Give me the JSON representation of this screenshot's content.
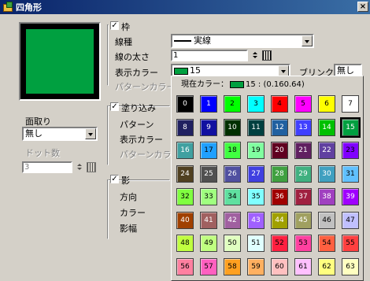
{
  "window": {
    "title": "四角形",
    "close": "×"
  },
  "frame": {
    "enabled_label": "枠",
    "line_type_label": "線種",
    "line_type_value": "実線",
    "line_width_label": "線の太さ",
    "line_width_value": "1",
    "display_color_label": "表示カラー",
    "display_color_value": "15",
    "display_color_swatch": "#00a040",
    "blink_label": "ブリンク",
    "blink_value": "無し",
    "pattern_color_label": "パターンカラー"
  },
  "chamfer": {
    "label": "面取り",
    "value": "無し",
    "dots_label": "ドット数",
    "dots_value": "3"
  },
  "fill": {
    "enabled_label": "塗り込み",
    "pattern_label": "パターン",
    "display_color_label": "表示カラー",
    "pattern_color_label": "パターンカラー"
  },
  "shadow": {
    "enabled_label": "影",
    "direction_label": "方向",
    "color_label": "カラー",
    "width_label": "影幅"
  },
  "palette": {
    "current_label": "現在カラー：",
    "current_value": "15 : (0.160.64)",
    "selected": 15,
    "cells": [
      {
        "n": "0",
        "bg": "#000000",
        "fg": "#ffffff"
      },
      {
        "n": "1",
        "bg": "#0000ff",
        "fg": "#ffffff"
      },
      {
        "n": "2",
        "bg": "#00ff00",
        "fg": "#000000"
      },
      {
        "n": "3",
        "bg": "#00ffff",
        "fg": "#000000"
      },
      {
        "n": "4",
        "bg": "#ff0000",
        "fg": "#000000"
      },
      {
        "n": "5",
        "bg": "#ff00ff",
        "fg": "#000000"
      },
      {
        "n": "6",
        "bg": "#ffff00",
        "fg": "#000000"
      },
      {
        "n": "7",
        "bg": "#ffffff",
        "fg": "#000000"
      },
      {
        "n": "8",
        "bg": "#202060",
        "fg": "#ffffff"
      },
      {
        "n": "9",
        "bg": "#1010a0",
        "fg": "#ffffff"
      },
      {
        "n": "10",
        "bg": "#003000",
        "fg": "#ffffff"
      },
      {
        "n": "11",
        "bg": "#004040",
        "fg": "#ffffff"
      },
      {
        "n": "12",
        "bg": "#2060a0",
        "fg": "#ffffff"
      },
      {
        "n": "13",
        "bg": "#4040ff",
        "fg": "#ffffff"
      },
      {
        "n": "14",
        "bg": "#00c000",
        "fg": "#ffffff"
      },
      {
        "n": "15",
        "bg": "#00a040",
        "fg": "#ffffff"
      },
      {
        "n": "16",
        "bg": "#40a0a0",
        "fg": "#ffffff"
      },
      {
        "n": "17",
        "bg": "#20a0ff",
        "fg": "#000000"
      },
      {
        "n": "18",
        "bg": "#40ff40",
        "fg": "#000000"
      },
      {
        "n": "19",
        "bg": "#80ffa0",
        "fg": "#000000"
      },
      {
        "n": "20",
        "bg": "#600020",
        "fg": "#ffffff"
      },
      {
        "n": "21",
        "bg": "#602060",
        "fg": "#ffffff"
      },
      {
        "n": "22",
        "bg": "#6040a0",
        "fg": "#ffffff"
      },
      {
        "n": "23",
        "bg": "#8000ff",
        "fg": "#000000"
      },
      {
        "n": "24",
        "bg": "#504020",
        "fg": "#ffffff"
      },
      {
        "n": "25",
        "bg": "#505050",
        "fg": "#ffffff"
      },
      {
        "n": "26",
        "bg": "#5050a0",
        "fg": "#ffffff"
      },
      {
        "n": "27",
        "bg": "#4040e0",
        "fg": "#ffffff"
      },
      {
        "n": "28",
        "bg": "#40a040",
        "fg": "#ffffff"
      },
      {
        "n": "29",
        "bg": "#40b080",
        "fg": "#ffffff"
      },
      {
        "n": "30",
        "bg": "#40a0c0",
        "fg": "#ffffff"
      },
      {
        "n": "31",
        "bg": "#60c0ff",
        "fg": "#000000"
      },
      {
        "n": "32",
        "bg": "#80ff40",
        "fg": "#000000"
      },
      {
        "n": "33",
        "bg": "#a0ff80",
        "fg": "#000000"
      },
      {
        "n": "34",
        "bg": "#60e0a0",
        "fg": "#000000"
      },
      {
        "n": "35",
        "bg": "#80ffff",
        "fg": "#000000"
      },
      {
        "n": "36",
        "bg": "#a00000",
        "fg": "#ffffff"
      },
      {
        "n": "37",
        "bg": "#a02040",
        "fg": "#ffffff"
      },
      {
        "n": "38",
        "bg": "#a040c0",
        "fg": "#ffffff"
      },
      {
        "n": "39",
        "bg": "#a000ff",
        "fg": "#ffffff"
      },
      {
        "n": "40",
        "bg": "#a04000",
        "fg": "#ffffff"
      },
      {
        "n": "41",
        "bg": "#a06060",
        "fg": "#ffffff"
      },
      {
        "n": "42",
        "bg": "#a060a0",
        "fg": "#ffffff"
      },
      {
        "n": "43",
        "bg": "#a060ff",
        "fg": "#ffffff"
      },
      {
        "n": "44",
        "bg": "#a0a000",
        "fg": "#ffffff"
      },
      {
        "n": "45",
        "bg": "#a0a060",
        "fg": "#ffffff"
      },
      {
        "n": "46",
        "bg": "#c0c0c0",
        "fg": "#000000"
      },
      {
        "n": "47",
        "bg": "#c0c0ff",
        "fg": "#000000"
      },
      {
        "n": "48",
        "bg": "#c0ff40",
        "fg": "#000000"
      },
      {
        "n": "49",
        "bg": "#c0ff80",
        "fg": "#000000"
      },
      {
        "n": "50",
        "bg": "#e0ffc0",
        "fg": "#000000"
      },
      {
        "n": "51",
        "bg": "#e0ffff",
        "fg": "#000000"
      },
      {
        "n": "52",
        "bg": "#ff2040",
        "fg": "#000000"
      },
      {
        "n": "53",
        "bg": "#ff40a0",
        "fg": "#000000"
      },
      {
        "n": "54",
        "bg": "#ff6040",
        "fg": "#000000"
      },
      {
        "n": "55",
        "bg": "#ff4040",
        "fg": "#000000"
      },
      {
        "n": "56",
        "bg": "#ff80a0",
        "fg": "#000000"
      },
      {
        "n": "57",
        "bg": "#ff60c0",
        "fg": "#000000"
      },
      {
        "n": "58",
        "bg": "#ffa020",
        "fg": "#000000"
      },
      {
        "n": "59",
        "bg": "#ffb060",
        "fg": "#000000"
      },
      {
        "n": "60",
        "bg": "#ffc0c0",
        "fg": "#000000"
      },
      {
        "n": "61",
        "bg": "#ffc0ff",
        "fg": "#000000"
      },
      {
        "n": "62",
        "bg": "#ffff80",
        "fg": "#000000"
      },
      {
        "n": "63",
        "bg": "#ffffc0",
        "fg": "#000000"
      }
    ]
  }
}
